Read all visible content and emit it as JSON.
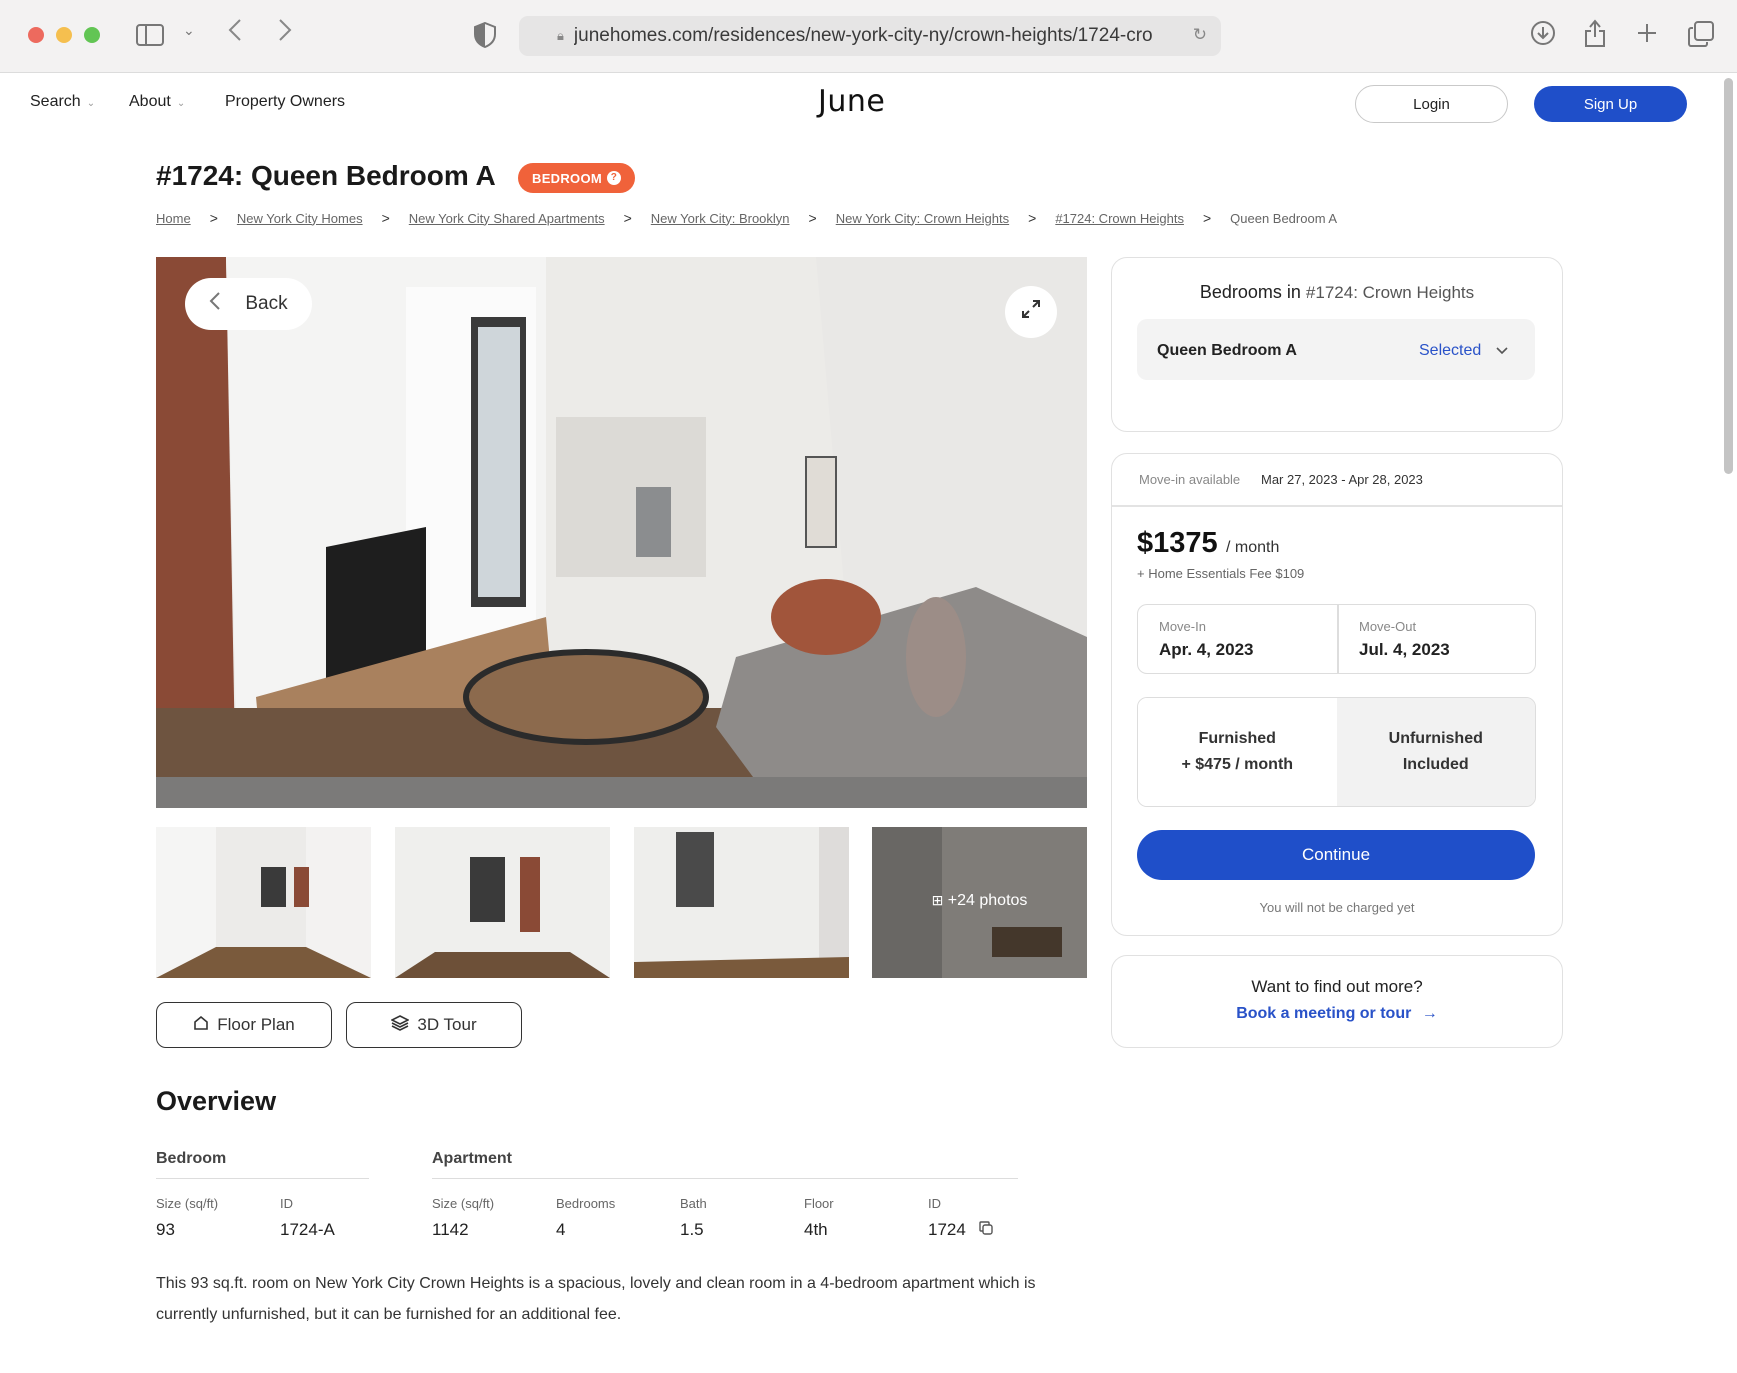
{
  "browser": {
    "url": "junehomes.com/residences/new-york-city-ny/crown-heights/1724-cro",
    "colors": {
      "close": "#ed6a5e",
      "minimize": "#f5bf4f",
      "zoom": "#62c554"
    }
  },
  "nav": {
    "search": "Search",
    "about": "About",
    "property_owners": "Property Owners",
    "logo": "June",
    "login": "Login",
    "signup": "Sign Up"
  },
  "listing": {
    "title": "#1724: Queen Bedroom A",
    "badge": "BEDROOM",
    "breadcrumbs": [
      "Home",
      "New York City Homes",
      "New York City Shared Apartments",
      "New York City: Brooklyn",
      "New York City: Crown Heights",
      "#1724: Crown Heights",
      "Queen Bedroom A"
    ]
  },
  "gallery": {
    "back": "Back",
    "more_photos": "+24 photos",
    "floor_plan": "Floor Plan",
    "tour_3d": "3D Tour"
  },
  "overview": {
    "heading": "Overview",
    "bedroom": {
      "heading": "Bedroom",
      "size_label": "Size (sq/ft)",
      "size": "93",
      "id_label": "ID",
      "id": "1724-A"
    },
    "apartment": {
      "heading": "Apartment",
      "size_label": "Size (sq/ft)",
      "size": "1142",
      "bedrooms_label": "Bedrooms",
      "bedrooms": "4",
      "bath_label": "Bath",
      "bath": "1.5",
      "floor_label": "Floor",
      "floor": "4th",
      "id_label": "ID",
      "id": "1724"
    },
    "description": "This 93 sq.ft. room on New York City Crown Heights is a spacious, lovely and clean room in a 4-bedroom apartment which is currently unfurnished, but it can be furnished for an additional fee."
  },
  "sidebar": {
    "bedrooms_heading": "Bedrooms in",
    "bedrooms_sub": "#1724: Crown Heights",
    "room_name": "Queen Bedroom A",
    "selected": "Selected",
    "movein_label": "Move-in available",
    "movein_dates": "Mar 27, 2023 - Apr 28, 2023",
    "price": "$1375",
    "per_month": "/ month",
    "fee": "+ Home Essentials Fee $109",
    "move_in_label": "Move-In",
    "move_in": "Apr. 4, 2023",
    "move_out_label": "Move-Out",
    "move_out": "Jul. 4, 2023",
    "furnished": "Furnished",
    "furnished_price": "+ $475 / month",
    "unfurnished": "Unfurnished",
    "unfurnished_price": "Included",
    "continue": "Continue",
    "no_charge": "You will not be charged yet",
    "find_out": "Want to find out more?",
    "book": "Book a meeting or tour"
  },
  "colors": {
    "accent": "#1f4fc9",
    "badge": "#f0623a",
    "link": "#2952c8"
  }
}
